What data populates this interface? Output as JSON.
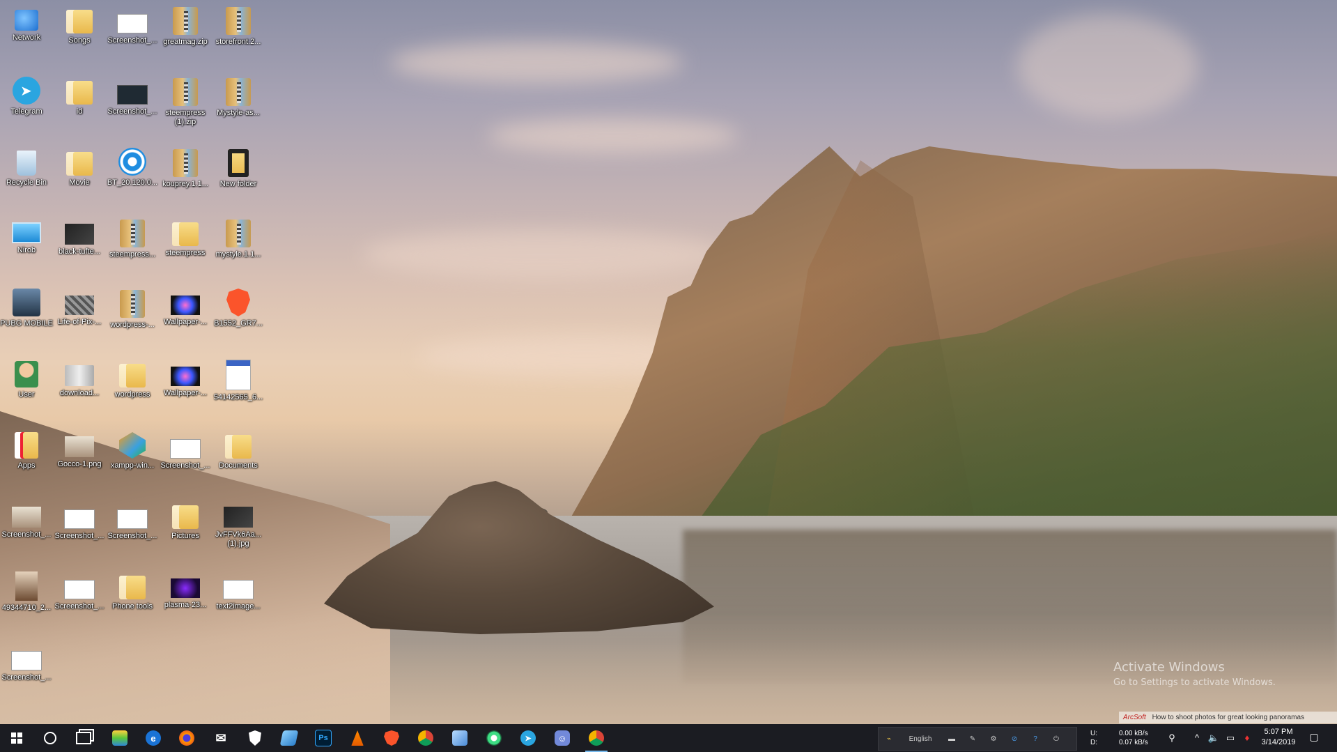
{
  "desktop": {
    "icons": [
      {
        "label": "Network",
        "icon": "network-icon"
      },
      {
        "label": "Songs",
        "icon": "folder-icon"
      },
      {
        "label": "Screenshot_...",
        "icon": "screenshot-file-icon"
      },
      {
        "label": "greatmag.zip",
        "icon": "zip-archive-icon"
      },
      {
        "label": "storefront.2...",
        "icon": "zip-archive-icon"
      },
      {
        "label": "Telegram",
        "icon": "telegram-icon"
      },
      {
        "label": "id",
        "icon": "folder-icon"
      },
      {
        "label": "Screenshot_...",
        "icon": "screenshot-file-icon"
      },
      {
        "label": "steempress (1).zip",
        "icon": "zip-archive-icon"
      },
      {
        "label": "Mystyle-as...",
        "icon": "zip-archive-icon"
      },
      {
        "label": "Recycle Bin",
        "icon": "recycle-bin-icon"
      },
      {
        "label": "Movie",
        "icon": "folder-icon"
      },
      {
        "label": "BT_20.120.0...",
        "icon": "bluetooth-installer-icon"
      },
      {
        "label": "kouprey.1.1...",
        "icon": "zip-archive-icon"
      },
      {
        "label": "New folder",
        "icon": "folder-icon"
      },
      {
        "label": "Nirob",
        "icon": "this-pc-icon"
      },
      {
        "label": "black-tufte...",
        "icon": "image-file-icon"
      },
      {
        "label": "steempress...",
        "icon": "zip-archive-icon"
      },
      {
        "label": "steempress",
        "icon": "folder-icon"
      },
      {
        "label": "mystyle.1.1...",
        "icon": "zip-archive-icon"
      },
      {
        "label": "PUBG MOBILE",
        "icon": "pubg-mobile-icon"
      },
      {
        "label": "Life-of-Pix-...",
        "icon": "image-file-icon"
      },
      {
        "label": "wordpress-...",
        "icon": "zip-archive-icon"
      },
      {
        "label": "Wallpaper-...",
        "icon": "image-file-icon"
      },
      {
        "label": "B1552_GR7...",
        "icon": "brave-icon"
      },
      {
        "label": "User",
        "icon": "user-folder-icon"
      },
      {
        "label": "download...",
        "icon": "image-file-icon"
      },
      {
        "label": "wordpress",
        "icon": "folder-icon"
      },
      {
        "label": "Wallpaper-...",
        "icon": "image-file-icon"
      },
      {
        "label": "54142565_6...",
        "icon": "image-file-icon"
      },
      {
        "label": "Apps",
        "icon": "folder-icon"
      },
      {
        "label": "Gocco-1.png",
        "icon": "image-file-icon"
      },
      {
        "label": "xampp-win...",
        "icon": "xampp-installer-icon"
      },
      {
        "label": "Screenshot_...",
        "icon": "screenshot-file-icon"
      },
      {
        "label": "Documents",
        "icon": "folder-icon"
      },
      {
        "label": "Screenshot_...",
        "icon": "screenshot-file-icon"
      },
      {
        "label": "Screenshot_...",
        "icon": "screenshot-file-icon"
      },
      {
        "label": "Screenshot_...",
        "icon": "screenshot-file-icon"
      },
      {
        "label": "Pictures",
        "icon": "folder-icon"
      },
      {
        "label": "JvFFVk6Aa... (1).jpg",
        "icon": "image-file-icon"
      },
      {
        "label": "49344710_2...",
        "icon": "image-file-icon"
      },
      {
        "label": "Screenshot_...",
        "icon": "screenshot-file-icon"
      },
      {
        "label": "Phone tools",
        "icon": "folder-icon"
      },
      {
        "label": "plasma-23...",
        "icon": "image-file-icon"
      },
      {
        "label": "text2image...",
        "icon": "image-file-icon"
      },
      {
        "label": "Screenshot_...",
        "icon": "screenshot-file-icon"
      }
    ]
  },
  "watermark": {
    "title": "Activate Windows",
    "subtitle": "Go to Settings to activate Windows."
  },
  "ad_strip": {
    "brand": "ArcSoft",
    "text": "How to shoot photos for great looking panoramas"
  },
  "taskbar": {
    "pinned": [
      {
        "name": "start-button",
        "icon": "windows-logo-icon"
      },
      {
        "name": "cortana-search-button",
        "icon": "cortana-circle-icon"
      },
      {
        "name": "task-view-button",
        "icon": "task-view-icon"
      },
      {
        "name": "taskbar-stack-app",
        "icon": "stack-app-icon"
      },
      {
        "name": "taskbar-edge",
        "icon": "edge-icon"
      },
      {
        "name": "taskbar-firefox",
        "icon": "firefox-icon"
      },
      {
        "name": "taskbar-mail",
        "icon": "mail-icon"
      },
      {
        "name": "taskbar-security",
        "icon": "shield-icon"
      },
      {
        "name": "taskbar-remote-desktop",
        "icon": "remote-desktop-icon"
      },
      {
        "name": "taskbar-photoshop",
        "icon": "photoshop-icon",
        "text": "Ps"
      },
      {
        "name": "taskbar-vlc",
        "icon": "vlc-cone-icon"
      },
      {
        "name": "taskbar-brave",
        "icon": "brave-icon"
      },
      {
        "name": "taskbar-chrome",
        "icon": "chrome-icon"
      },
      {
        "name": "taskbar-3d-viewer",
        "icon": "cube-icon"
      },
      {
        "name": "taskbar-android-studio",
        "icon": "android-studio-icon"
      },
      {
        "name": "taskbar-telegram",
        "icon": "telegram-icon"
      },
      {
        "name": "taskbar-discord",
        "icon": "discord-icon"
      },
      {
        "name": "taskbar-chrome-active",
        "icon": "chrome-icon",
        "active": true
      }
    ],
    "language_bar": {
      "language": "English"
    },
    "network_speed": {
      "up_label": "U:",
      "down_label": "D:",
      "up_value": "0.00 kB/s",
      "down_value": "0.07 kB/s"
    },
    "clock": {
      "time": "5:07 PM",
      "date": "3/14/2019"
    }
  },
  "colors": {
    "taskbar_bg": "#1b1c22",
    "active_indicator": "#76b9ed",
    "brave_orange": "#fb542b",
    "telegram_blue": "#2aa5e0"
  }
}
